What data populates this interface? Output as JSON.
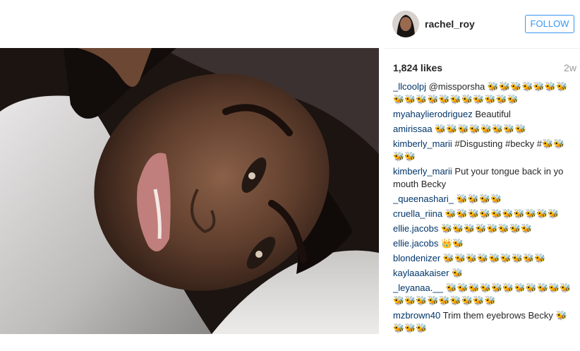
{
  "post": {
    "username": "rachel_roy",
    "follow_label": "FOLLOW",
    "likes": "1,824 likes",
    "age": "2w"
  },
  "comments": [
    {
      "author": "_llcoolpj",
      "text": "@missporsha 🐝🐝🐝🐝🐝🐝🐝🐝🐝🐝🐝🐝🐝🐝🐝🐝🐝🐝"
    },
    {
      "author": "myahaylierodriguez",
      "text": "Beautiful"
    },
    {
      "author": "amirissaa",
      "text": "🐝🐝🐝🐝🐝🐝🐝🐝"
    },
    {
      "author": "kimberly_marii",
      "text": "#Disgusting #becky #🐝🐝🐝🐝"
    },
    {
      "author": "kimberly_marii",
      "text": "Put your tongue back in yo mouth Becky"
    },
    {
      "author": "_queenashari_",
      "text": "🐝🐝🐝🐝"
    },
    {
      "author": "cruella_riina",
      "text": "🐝🐝🐝🐝🐝🐝🐝🐝🐝🐝"
    },
    {
      "author": "ellie.jacobs",
      "text": "🐝🐝🐝🐝🐝🐝🐝🐝"
    },
    {
      "author": "ellie.jacobs",
      "text": "👑🐝"
    },
    {
      "author": "blondenizer",
      "text": "🐝🐝🐝🐝🐝🐝🐝🐝🐝"
    },
    {
      "author": "kaylaaakaiser",
      "text": "🐝"
    },
    {
      "author": "_leyanaa.__",
      "text": "🐝🐝🐝🐝🐝🐝🐝🐝🐝🐝🐝🐝🐝🐝🐝🐝🐝🐝🐝🐝"
    },
    {
      "author": "mzbrown40",
      "text": "Trim them eyebrows Becky 🐝🐝🐝🐝"
    }
  ],
  "colors": {
    "author": "#003569",
    "follow": "#3897f0",
    "muted": "#999999"
  },
  "icons": {
    "avatar": "profile-avatar"
  }
}
